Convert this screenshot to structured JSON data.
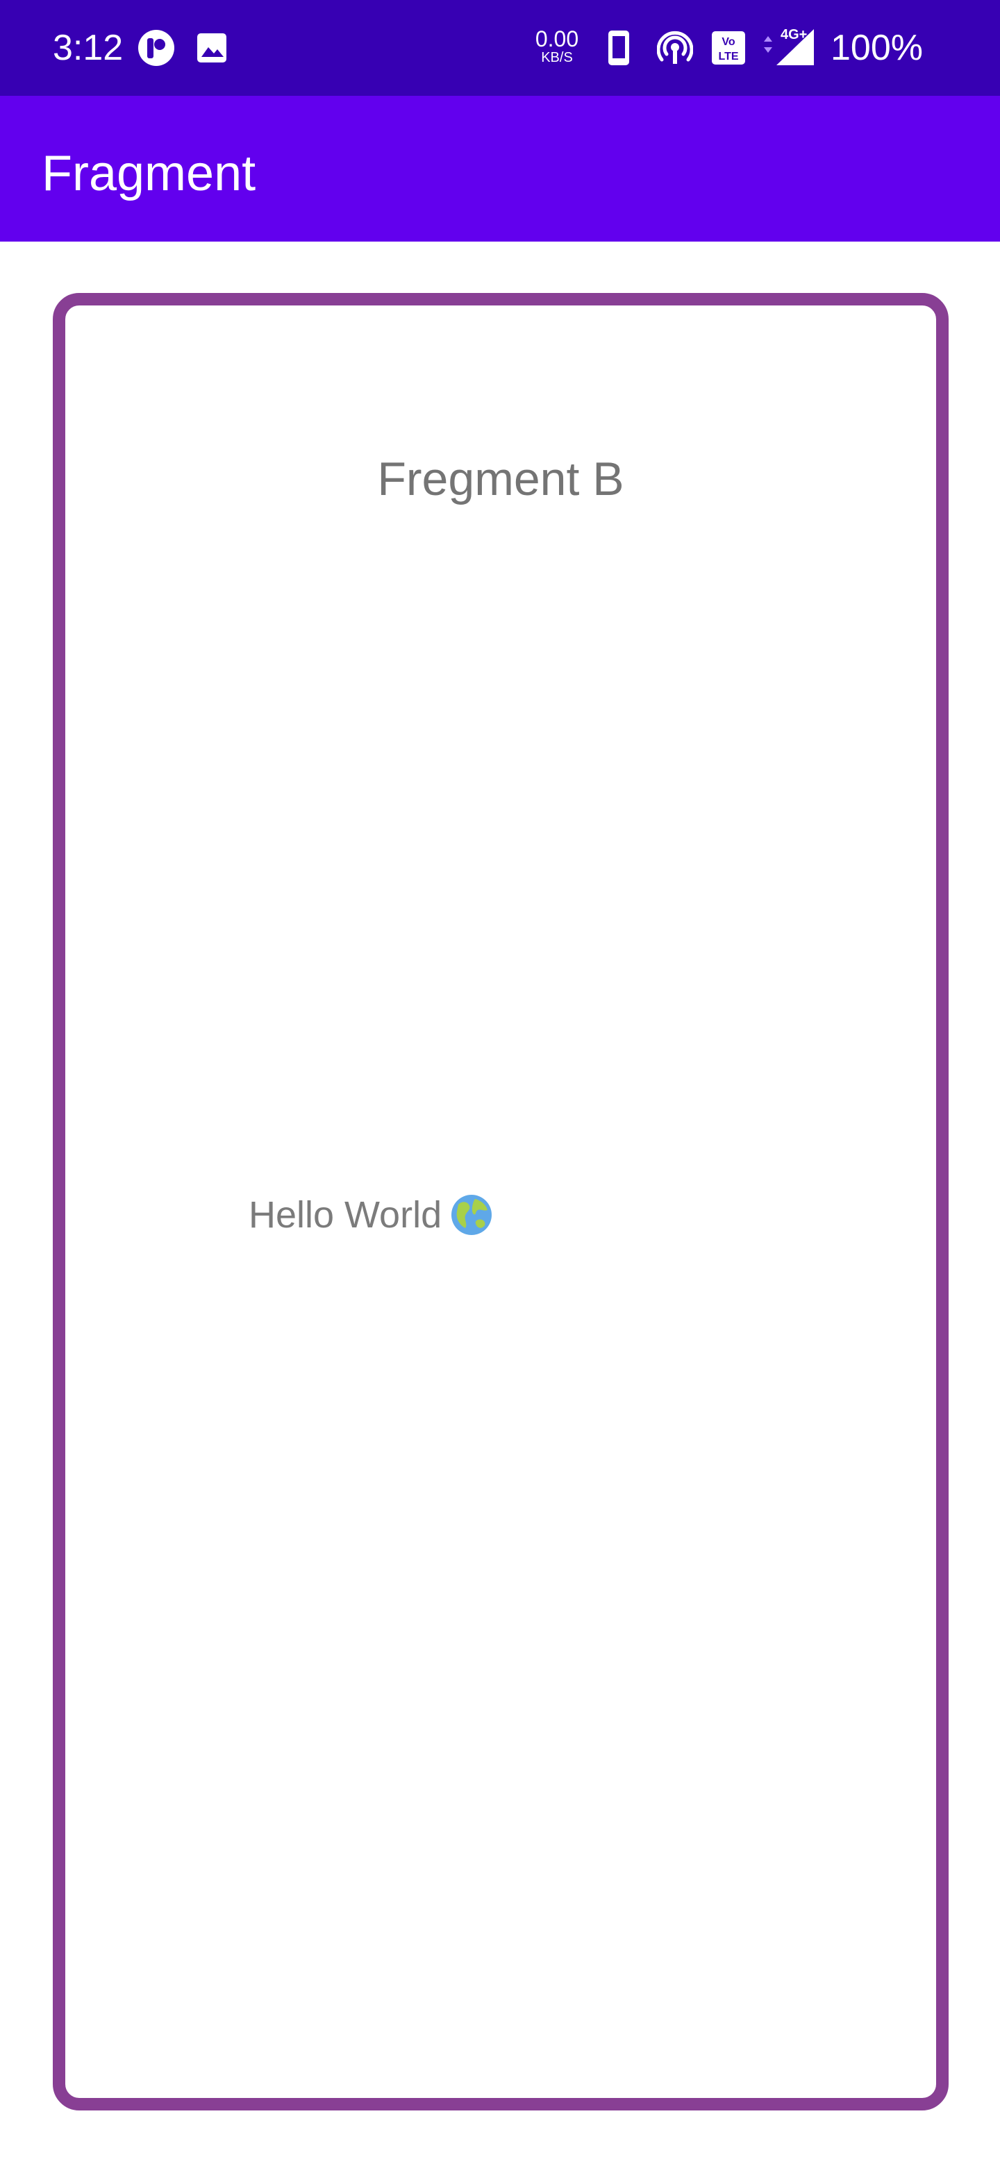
{
  "status_bar": {
    "time": "3:12",
    "network_speed_value": "0.00",
    "network_speed_unit": "KB/S",
    "volte_label": "VoLTE",
    "network_type": "4G+",
    "battery": "100%",
    "icons": [
      "app-notification-icon",
      "image-icon",
      "phone-icon",
      "hotspot-icon",
      "volte-icon",
      "signal-icon"
    ]
  },
  "app_bar": {
    "title": "Fragment"
  },
  "fragment": {
    "title": "Fregment B",
    "message": "Hello World",
    "message_icon": "globe-icon"
  },
  "colors": {
    "status_bar": "#3700b3",
    "app_bar": "#6200ee",
    "card_border": "#883f94",
    "text_gray": "#747474"
  }
}
